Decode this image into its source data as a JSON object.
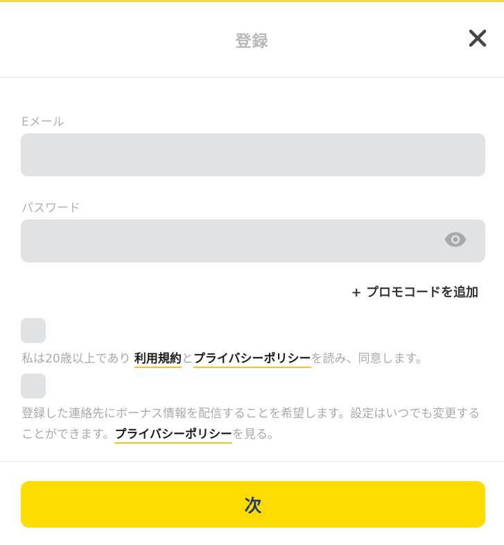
{
  "header": {
    "title": "登録",
    "close_icon": "close-icon"
  },
  "form": {
    "email": {
      "label": "Eメール",
      "value": "",
      "placeholder": ""
    },
    "password": {
      "label": "パスワード",
      "value": "",
      "placeholder": "",
      "toggle_icon": "eye-icon"
    },
    "promo_link": "+ プロモコードを追加"
  },
  "consents": {
    "age": {
      "checked": false,
      "text_before": "私は20歳以上であり ",
      "terms_link": "利用規約",
      "text_and": "と",
      "privacy_link": "プライバシーポリシー",
      "text_after": "を読み、同意します。"
    },
    "marketing": {
      "checked": false,
      "text_before": "登録した連絡先にボーナス情報を配信することを希望します。設定はいつでも変更することができます。",
      "privacy_link": "プライバシーポリシー",
      "text_after": "を見る。"
    }
  },
  "footer": {
    "next_label": "次"
  },
  "colors": {
    "accent": "#ffdb00",
    "link_underline": "#f2c80f",
    "button_text": "#1f3b76",
    "field_bg": "#e1e2e3"
  }
}
